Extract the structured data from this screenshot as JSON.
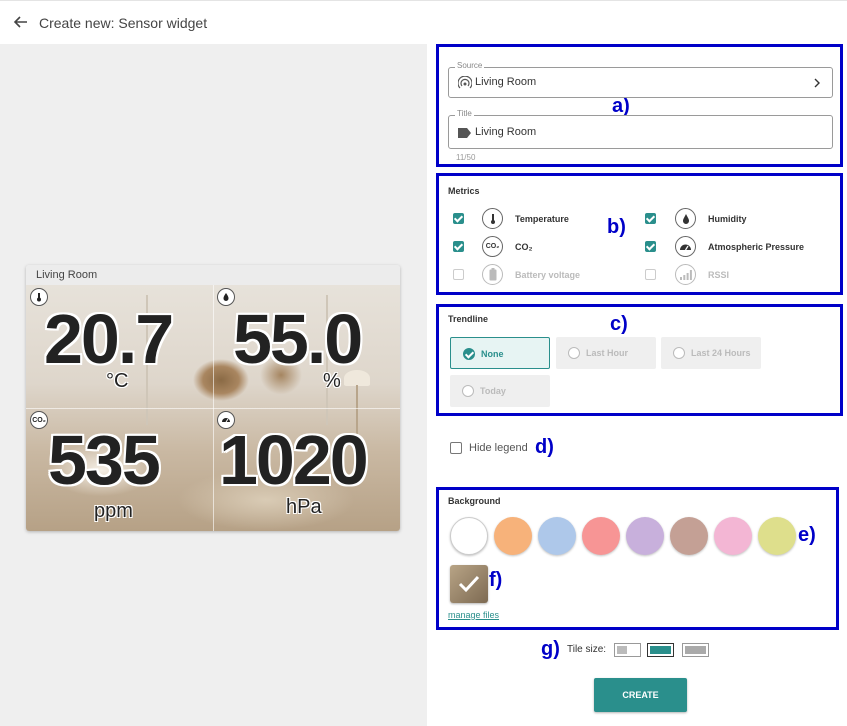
{
  "header": {
    "title": "Create new: Sensor widget"
  },
  "preview": {
    "tile_title": "Living Room",
    "readings": [
      {
        "icon": "thermometer",
        "value": "20.7",
        "unit": "°C"
      },
      {
        "icon": "humidity-drop",
        "value": "55.0",
        "unit": "%"
      },
      {
        "icon": "co2",
        "icon_text": "CO₂",
        "value": "535",
        "unit": "ppm"
      },
      {
        "icon": "pressure-gauge",
        "value": "1020",
        "unit": "hPa"
      }
    ]
  },
  "annotations": {
    "a": "a)",
    "b": "b)",
    "c": "c)",
    "d": "d)",
    "e": "e)",
    "f": "f)",
    "g": "g)"
  },
  "source": {
    "label": "Source",
    "value": "Living Room",
    "icon": "sensor-signal"
  },
  "title_field": {
    "label": "Title",
    "value": "Living Room",
    "counter": "11/50",
    "icon": "tag"
  },
  "metrics": {
    "title": "Metrics",
    "items": [
      {
        "label": "Temperature",
        "checked": true,
        "enabled": true,
        "icon": "thermometer"
      },
      {
        "label": "Humidity",
        "checked": true,
        "enabled": true,
        "icon": "humidity-drop"
      },
      {
        "label": "CO₂",
        "checked": true,
        "enabled": true,
        "icon": "co2",
        "icon_text": "CO₂"
      },
      {
        "label": "Atmospheric Pressure",
        "checked": true,
        "enabled": true,
        "icon": "pressure-gauge"
      },
      {
        "label": "Battery voltage",
        "checked": false,
        "enabled": false,
        "icon": "battery"
      },
      {
        "label": "RSSI",
        "checked": false,
        "enabled": false,
        "icon": "signal-bars"
      }
    ]
  },
  "trendline": {
    "title": "Trendline",
    "options": [
      "None",
      "Last Hour",
      "Last 24 Hours",
      "Today"
    ],
    "selected": "None"
  },
  "hide_legend": {
    "label": "Hide legend",
    "checked": false
  },
  "background": {
    "title": "Background",
    "colors": [
      "#ffffff",
      "#f7b27a",
      "#aec8ea",
      "#f79595",
      "#c8b0dc",
      "#c4a095",
      "#f3b6d4",
      "#dedf8c"
    ],
    "manage_files": "manage files"
  },
  "tile_size": {
    "label": "Tile size:",
    "selected_index": 1
  },
  "actions": {
    "create": "CREATE"
  }
}
